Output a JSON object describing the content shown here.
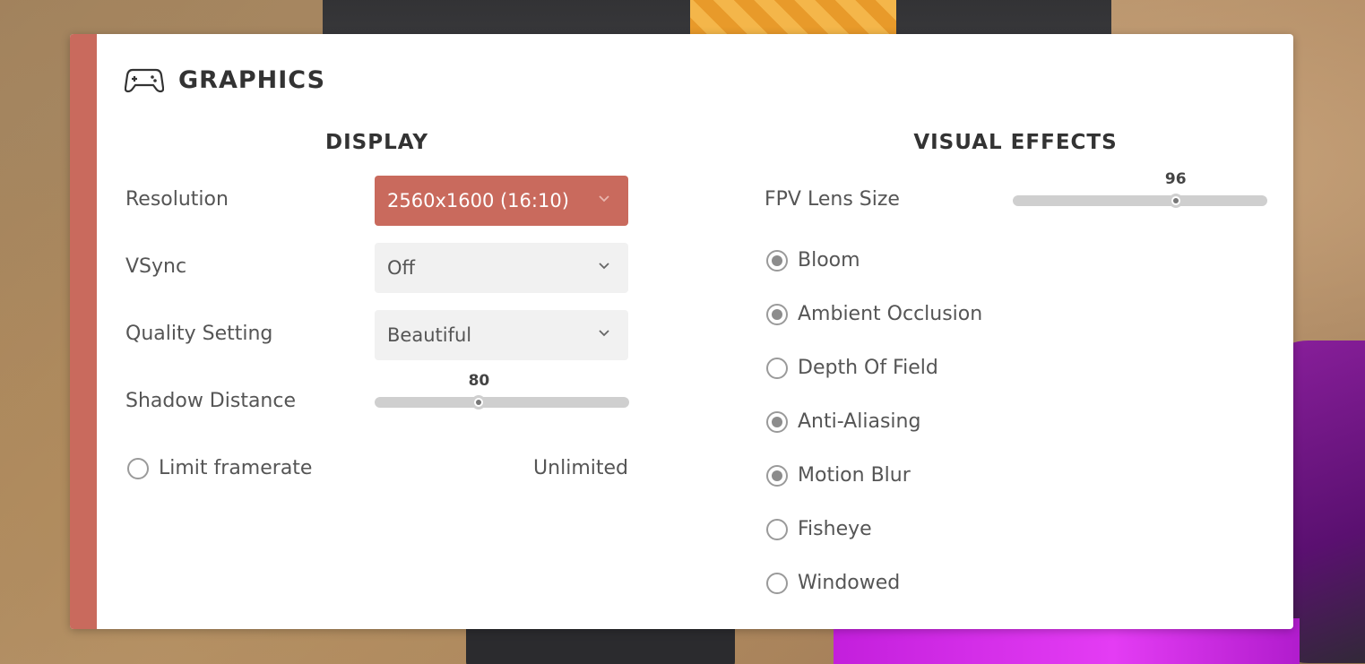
{
  "panel": {
    "title": "GRAPHICS",
    "icon": "gamepad-icon",
    "accent_color": "#c96a5d"
  },
  "display": {
    "title": "DISPLAY",
    "resolution": {
      "label": "Resolution",
      "value": "2560x1600 (16:10)"
    },
    "vsync": {
      "label": "VSync",
      "value": "Off"
    },
    "quality": {
      "label": "Quality Setting",
      "value": "Beautiful"
    },
    "shadow_distance": {
      "label": "Shadow Distance",
      "value": "80",
      "fraction": 0.41
    },
    "limit_framerate": {
      "label": "Limit framerate",
      "checked": false,
      "value": "Unlimited"
    }
  },
  "visual_effects": {
    "title": "VISUAL EFFECTS",
    "fpv_lens": {
      "label": "FPV Lens Size",
      "value": "96",
      "fraction": 0.64
    },
    "options": [
      {
        "label": "Bloom",
        "checked": true
      },
      {
        "label": "Ambient Occlusion",
        "checked": true
      },
      {
        "label": "Depth Of Field",
        "checked": false
      },
      {
        "label": "Anti-Aliasing",
        "checked": true
      },
      {
        "label": "Motion Blur",
        "checked": true
      },
      {
        "label": "Fisheye",
        "checked": false
      },
      {
        "label": "Windowed",
        "checked": false
      }
    ]
  }
}
